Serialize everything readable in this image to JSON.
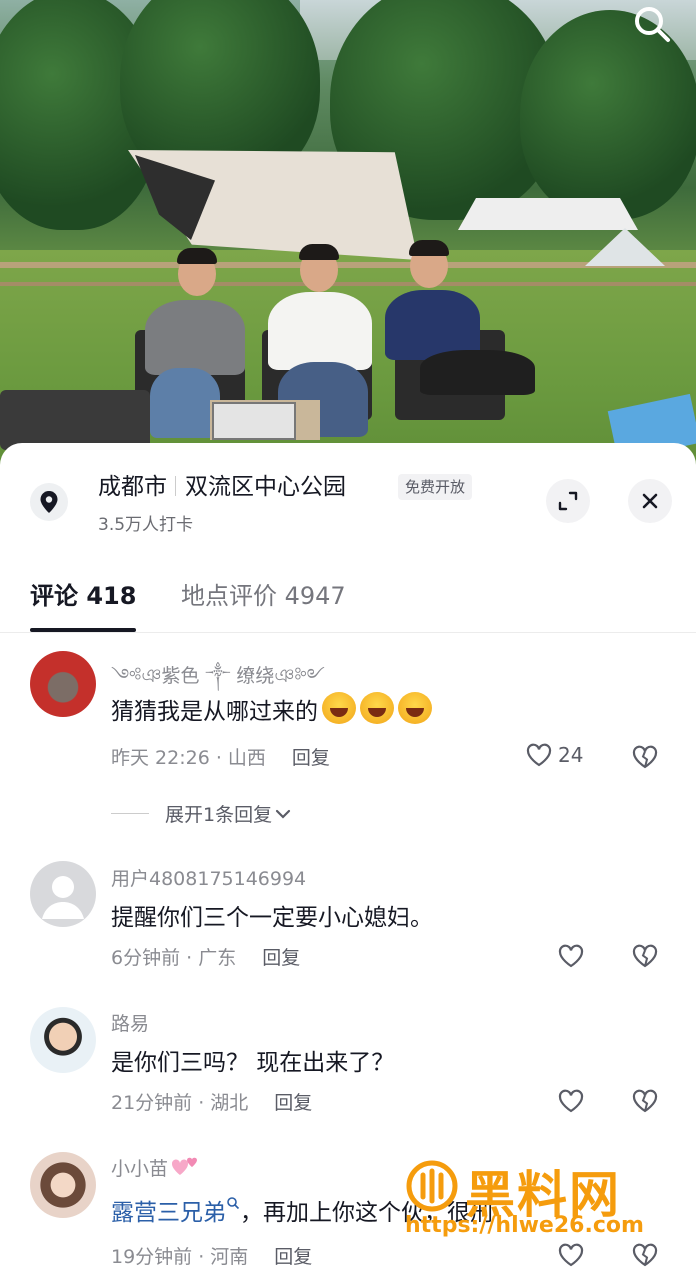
{
  "header": {
    "search_icon": "search-icon"
  },
  "location": {
    "city": "成都市",
    "name": "双流区中心公园",
    "badge": "免费开放",
    "checkins": "3.5万人打卡",
    "icons": [
      "map-pin-icon",
      "expand-icon",
      "close-icon"
    ]
  },
  "tabs": [
    {
      "label": "评论 418",
      "active": true
    },
    {
      "label": "地点评价 4947",
      "active": false
    }
  ],
  "comments": [
    {
      "username": "༺ঞ紫色 ༒ 缭绕ঞ༻",
      "text": "猜猜我是从哪过来的",
      "time_region": "昨天 22:26 · 山西",
      "reply": "回复",
      "likes": "24",
      "expand": "展开1条回复"
    },
    {
      "username": "用户4808175146994",
      "text": "提醒你们三个一定要小心媳妇。",
      "time_region": "6分钟前 · 广东",
      "reply": "回复"
    },
    {
      "username": "路易",
      "text": "是你们三吗？ 现在出来了？",
      "time_region": "21分钟前 · 湖北",
      "reply": "回复"
    },
    {
      "username": "小小苗",
      "mention": "露营三兄弟",
      "text": "，再加上你这个伙，很刑",
      "time_region": "19分钟前 · 河南",
      "reply": "回复"
    }
  ],
  "watermark": {
    "title": "黑料网",
    "url": "https://hlwe26.com"
  },
  "colors": {
    "accent": "#161823",
    "secondary": "#8a8b91",
    "mention": "#2b5fa8",
    "watermark": "#f59c0d"
  }
}
